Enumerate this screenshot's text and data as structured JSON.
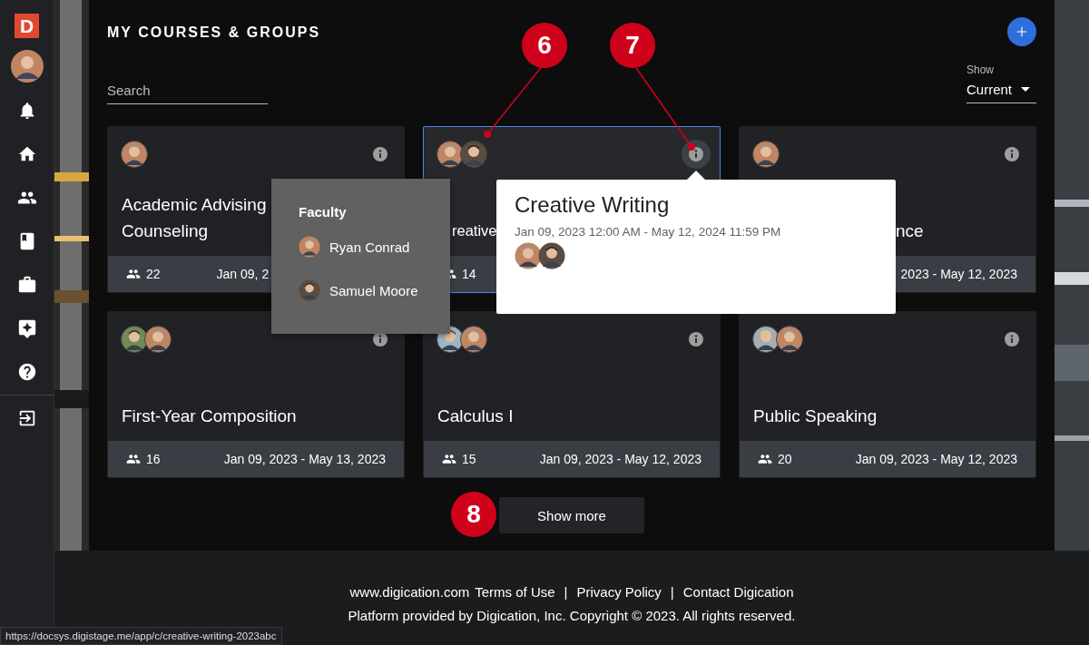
{
  "sidebar": {
    "logo": "D"
  },
  "header": {
    "title": "MY COURSES & GROUPS"
  },
  "search": {
    "placeholder": "Search"
  },
  "show_filter": {
    "label": "Show",
    "value": "Current"
  },
  "cards": [
    {
      "title": "Academic Advising Counseling",
      "members": "22",
      "dates": "Jan 09, 2",
      "selected": false,
      "avatars": [
        {
          "kind": "gray"
        }
      ]
    },
    {
      "title": "reative",
      "members": "14",
      "selected": true,
      "avatars": [
        {
          "kind": "gray"
        },
        {
          "kind": "beard"
        }
      ]
    },
    {
      "title": "nce",
      "dates": "2023 - May 12, 2023",
      "selected": false,
      "avatars": [
        {
          "kind": "gray"
        }
      ]
    },
    {
      "title": "First-Year Composition",
      "members": "16",
      "dates": "Jan 09, 2023 - May 13, 2023",
      "selected": false,
      "avatars": [
        {
          "kind": "young"
        },
        {
          "kind": "gray"
        }
      ]
    },
    {
      "title": "Calculus I",
      "members": "15",
      "dates": "Jan 09, 2023 - May 12, 2023",
      "selected": false,
      "avatars": [
        {
          "kind": "woman"
        },
        {
          "kind": "gray"
        }
      ]
    },
    {
      "title": "Public Speaking",
      "members": "20",
      "dates": "Jan 09, 2023 - May 12, 2023",
      "selected": false,
      "avatars": [
        {
          "kind": "blonde"
        },
        {
          "kind": "gray"
        }
      ]
    }
  ],
  "faculty_popup": {
    "heading": "Faculty",
    "members": [
      {
        "name": "Ryan Conrad",
        "avatar": {
          "kind": "gray"
        }
      },
      {
        "name": "Samuel Moore",
        "avatar": {
          "kind": "beard"
        }
      }
    ]
  },
  "tooltip": {
    "title": "Creative Writing",
    "dates": "Jan 09, 2023 12:00 AM - May 12, 2024 11:59 PM",
    "avatars": [
      {
        "kind": "gray"
      },
      {
        "kind": "beard"
      }
    ]
  },
  "show_more": "Show more",
  "callouts": [
    {
      "label": "6"
    },
    {
      "label": "7"
    },
    {
      "label": "8"
    }
  ],
  "footer": {
    "items": [
      {
        "kind": "link",
        "text": "www.digication.com"
      },
      {
        "kind": "link",
        "text": "Terms of Use"
      },
      {
        "kind": "separator",
        "text": "|"
      },
      {
        "kind": "link",
        "text": "Privacy Policy"
      },
      {
        "kind": "separator",
        "text": "|"
      },
      {
        "kind": "link",
        "text": "Contact Digication"
      }
    ],
    "copyright": "Platform provided by Digication, Inc. Copyright © 2023. All rights reserved."
  },
  "status_url": "https://docsys.digistage.me/app/c/creative-writing-2023abc"
}
